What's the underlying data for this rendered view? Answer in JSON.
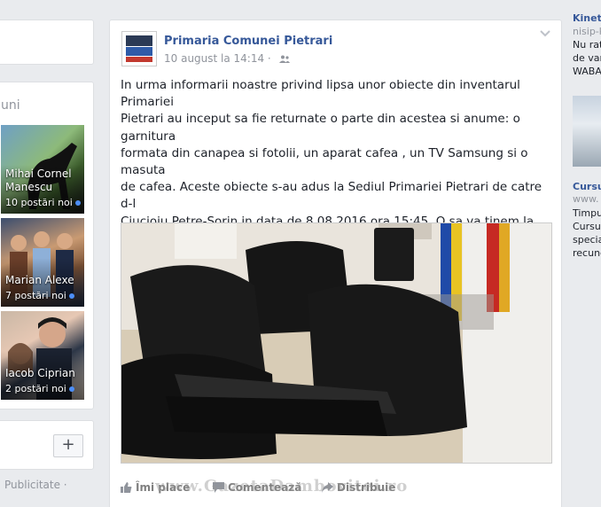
{
  "left": {
    "groups_title": "uni",
    "groups": [
      {
        "name": "Mihai Cornel Manescu",
        "posts": "10 postări noi"
      },
      {
        "name": "Marian Alexe",
        "posts": "7 postări noi"
      },
      {
        "name": "Iacob Ciprian",
        "posts": "2 postări noi"
      }
    ],
    "bottom_card_text": ")",
    "plus_label": "+",
    "footer": "Publicitate ·"
  },
  "post": {
    "page_name": "Primaria Comunei Pietrari",
    "timestamp": "10 august la 14:14 ·",
    "text": "In urma informarii noastre privind lipsa unor obiecte din inventarul Primariei\nPietrari au inceput sa fie returnate o parte din acestea si anume: o garnitura\nformata din canapea si fotolii, un aparat cafea , un TV Samsung si o masuta\nde cafea. Aceste obiecte s-au adus la Sediul Primariei Pietrari de catre d-l\nCiucioiu Petre-Sorin in data de 8.08.2016 ora 15:45. O sa va tinem la curent\ncu orice noutati asa cum v-am promis.\nPrimar,\ning. Gheorghe Neascu",
    "actions": {
      "like": "Îmi place",
      "comment": "Comentează",
      "share": "Distribuie"
    },
    "watermark": "www.GazetaDambovitei.ro"
  },
  "right": {
    "ad1": {
      "title": "Kineti",
      "link": "nisip-k",
      "body": "Nu rata\nde var\nWABA"
    },
    "ad2": {
      "title": "Cursu",
      "link": "www.",
      "body": "Timpul\nCursur\nspecia\nrecunc"
    }
  }
}
